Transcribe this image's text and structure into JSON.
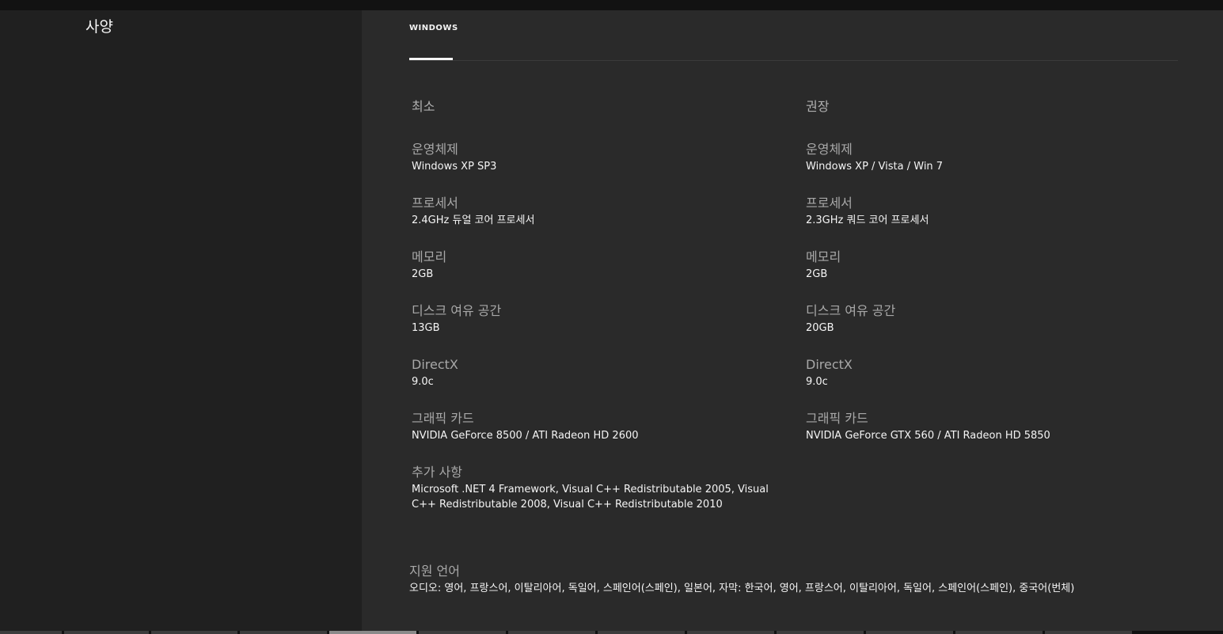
{
  "section": {
    "title": "사양"
  },
  "tabs": [
    {
      "label": "WINDOWS"
    }
  ],
  "minimum": {
    "heading": "최소",
    "specs": [
      {
        "label": "운영체제",
        "value": "Windows XP SP3"
      },
      {
        "label": "프로세서",
        "value": "2.4GHz 듀얼 코어 프로세서"
      },
      {
        "label": "메모리",
        "value": "2GB"
      },
      {
        "label": "디스크 여유 공간",
        "value": "13GB"
      },
      {
        "label": "DirectX",
        "value": "9.0c"
      },
      {
        "label": "그래픽 카드",
        "value": "NVIDIA GeForce 8500 / ATI Radeon HD 2600"
      },
      {
        "label": "추가 사항",
        "value": "Microsoft .NET 4 Framework, Visual C++ Redistributable 2005, Visual C++ Redistributable 2008, Visual C++ Redistributable 2010"
      }
    ]
  },
  "recommended": {
    "heading": "권장",
    "specs": [
      {
        "label": "운영체제",
        "value": "Windows XP / Vista / Win 7"
      },
      {
        "label": "프로세서",
        "value": "2.3GHz 쿼드 코어 프로세서"
      },
      {
        "label": "메모리",
        "value": "2GB"
      },
      {
        "label": "디스크 여유 공간",
        "value": "20GB"
      },
      {
        "label": "DirectX",
        "value": "9.0c"
      },
      {
        "label": "그래픽 카드",
        "value": "NVIDIA GeForce GTX 560 / ATI Radeon HD 5850"
      }
    ]
  },
  "languages": {
    "label": "지원 언어",
    "value": "오디오: 영어, 프랑스어, 이탈리아어, 독일어, 스페인어(스페인), 일본어, 자막: 한국어, 영어, 프랑스어, 이탈리아어, 독일어, 스페인어(스페인), 중국어(번체)"
  }
}
